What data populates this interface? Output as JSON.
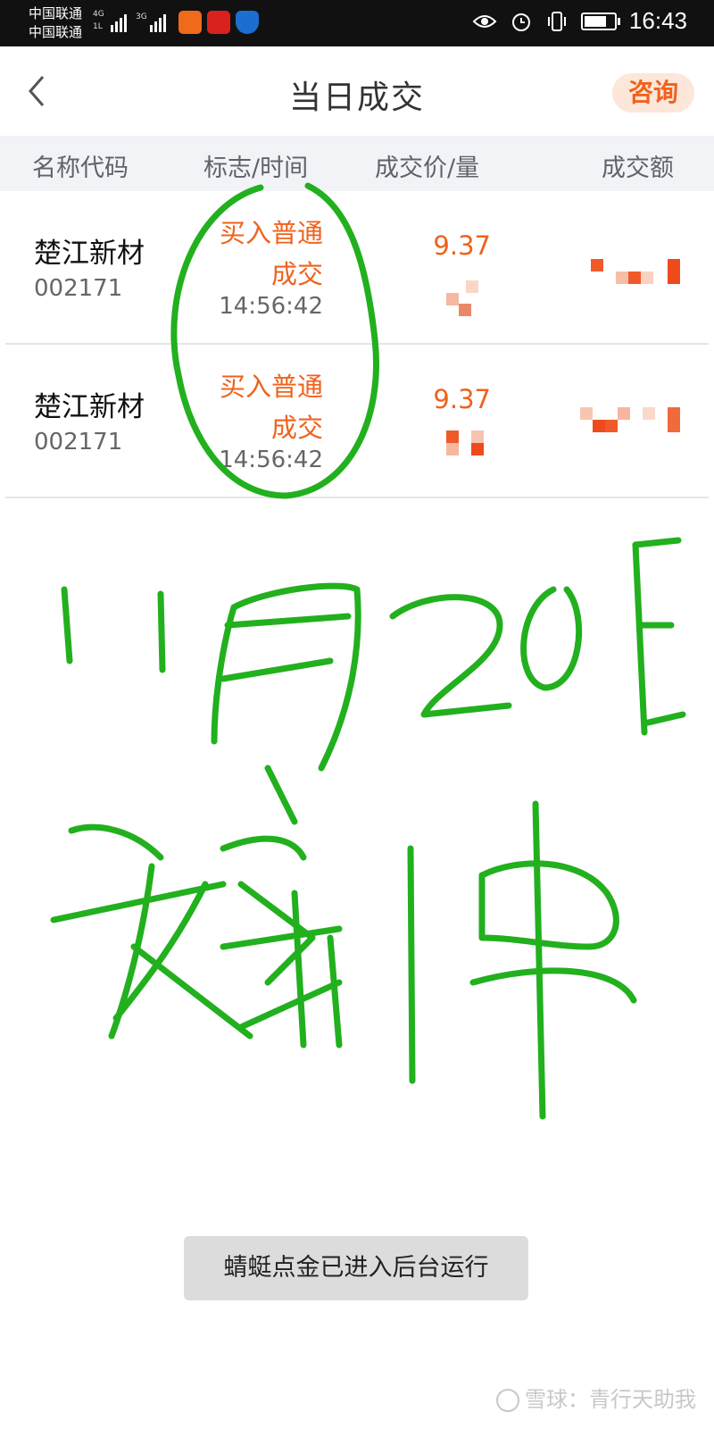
{
  "status_bar": {
    "carrier_1": "中国联通",
    "carrier_2": "中国联通",
    "net_1": "4G",
    "net_1b": "1L",
    "net_2": "3G",
    "time": "16:43"
  },
  "nav": {
    "title": "当日成交",
    "consult_label": "咨询"
  },
  "table": {
    "headers": [
      "名称代码",
      "标志/时间",
      "成交价/量",
      "成交额"
    ],
    "rows": [
      {
        "name": "楚江新材",
        "code": "002171",
        "flag_line1": "买入普通",
        "flag_line2": "成交",
        "time": "14:56:42",
        "price": "9.37"
      },
      {
        "name": "楚江新材",
        "code": "002171",
        "flag_line1": "买入普通",
        "flag_line2": "成交",
        "time": "14:56:42",
        "price": "9.37"
      }
    ]
  },
  "toast": {
    "text": "蜻蜓点金已进入后台运行"
  },
  "watermark": {
    "text": "雪球：青行天助我"
  },
  "colors": {
    "accent": "#f0621c",
    "header_bg": "#f1f3f7",
    "handwriting": "#22b01e"
  },
  "icons": [
    "back-chevron-icon",
    "eye-icon",
    "alarm-icon",
    "vibrate-icon",
    "battery-icon",
    "signal-icon"
  ]
}
